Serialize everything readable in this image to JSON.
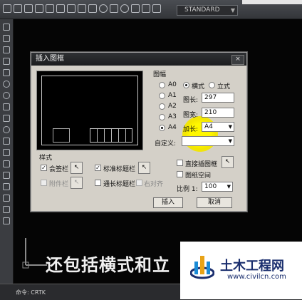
{
  "toolbar": {
    "style_value": "STANDARD"
  },
  "dialog": {
    "title": "插入图框",
    "close_label": "×",
    "frame_section_label": "图幅",
    "sizes": [
      {
        "label": "A0",
        "selected": false
      },
      {
        "label": "A1",
        "selected": false
      },
      {
        "label": "A2",
        "selected": false
      },
      {
        "label": "A3",
        "selected": false
      },
      {
        "label": "A4",
        "selected": true
      }
    ],
    "orientation": {
      "landscape": "横式",
      "portrait": "立式",
      "selected": "横式"
    },
    "length_label": "图长:",
    "length_value": "297",
    "width_label": "图宽:",
    "width_value": "210",
    "extend_label": "加长:",
    "extend_value": "A4",
    "custom_label": "自定义:",
    "custom_value": "",
    "style_section_label": "样式",
    "style_checks": {
      "countersign": {
        "label": "会签栏",
        "checked": true
      },
      "standard_title": {
        "label": "标准标题栏",
        "checked": true
      },
      "attachment": {
        "label": "附件栏",
        "checked": false,
        "disabled": true
      },
      "full_title": {
        "label": "通长标题栏",
        "checked": false
      },
      "right_align": {
        "label": "右对齐",
        "checked": false,
        "disabled": true
      }
    },
    "direct_insert": {
      "label": "直接插图框",
      "checked": false
    },
    "paper_space": {
      "label": "图纸空间",
      "checked": false
    },
    "scale_label": "比例 1:",
    "scale_value": "100",
    "insert_button": "插入",
    "cancel_button": "取消"
  },
  "command_line": {
    "prefix": "命令:",
    "text": "CRTK"
  },
  "subtitle": "还包括横式和立",
  "watermark": {
    "title": "土木工程网",
    "url": "www.civilcn.com"
  },
  "colors": {
    "highlight": "#fff700",
    "watermark_text": "#1a2e6e"
  }
}
